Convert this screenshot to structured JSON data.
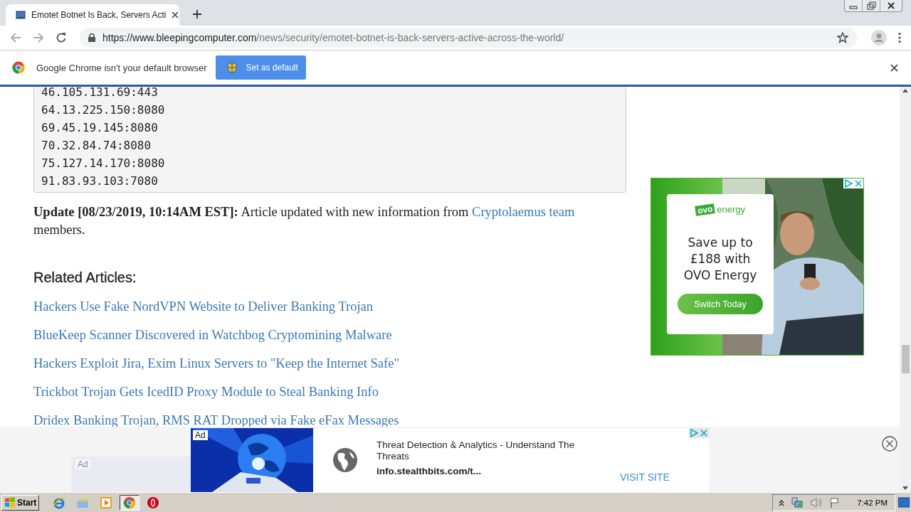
{
  "browser": {
    "tab": {
      "title": "Emotet Botnet Is Back, Servers Acti",
      "selected": true
    },
    "address": {
      "host": "https://www.bleepingcomputer.com",
      "path": "/news/security/emotet-botnet-is-back-servers-active-across-the-world/"
    },
    "infobar": {
      "message": "Google Chrome isn't your default browser",
      "button": "Set as default"
    }
  },
  "article": {
    "code_lines": [
      "46.105.131.69:443",
      "64.13.225.150:8080",
      "69.45.19.145:8080",
      "70.32.84.74:8080",
      "75.127.14.170:8080",
      "91.83.93.103:7080"
    ],
    "update": {
      "text": "**Update [08/23/2019, 10:14AM EST]:** Article updated with new information from ",
      "link": "Cryptolaemus team",
      "after": " members."
    },
    "related_heading": "Related Articles:",
    "related_links": [
      "Hackers Use Fake NordVPN Website to Deliver Banking Trojan",
      "BlueKeep Scanner Discovered in Watchbog Cryptomining Malware",
      "Hackers Exploit Jira, Exim Linux Servers to \"Keep the Internet Safe\"",
      "Trickbot Trojan Gets IcedID Proxy Module to Steal Banking Info",
      "Dridex Banking Trojan, RMS RAT Dropped via Fake eFax Messages"
    ]
  },
  "side_ad": {
    "logo": "ovo",
    "logo_word": "energy",
    "headline": "Save up to £188 with OVO Energy",
    "button": "Switch Today"
  },
  "bottom_ad": {
    "faded_label": "Ad",
    "label": "Ad",
    "title": "Threat Detection & Analytics - Understand The Threats",
    "domain": "info.stealthbits.com/t...",
    "action": "VISIT SITE"
  },
  "taskbar": {
    "start": "Start",
    "clock": "7:42 PM",
    "apps": [
      {
        "kind": "ie",
        "selected": false
      },
      {
        "kind": "folder",
        "selected": false
      },
      {
        "kind": "media",
        "selected": false
      },
      {
        "kind": "chrome",
        "selected": true
      },
      {
        "kind": "opera",
        "selected": false
      }
    ]
  }
}
